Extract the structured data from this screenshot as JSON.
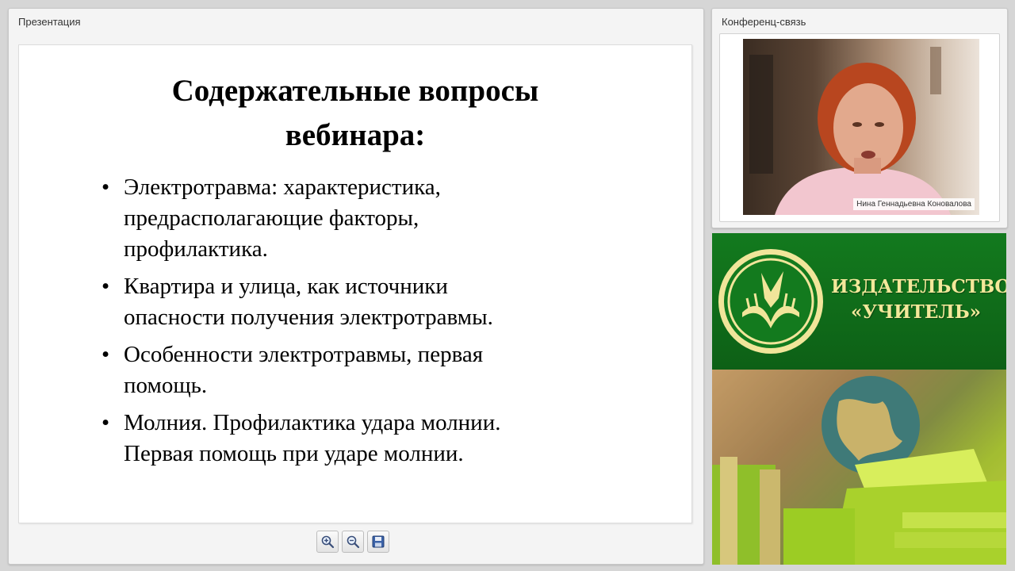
{
  "presentation": {
    "title": "Презентация",
    "slide": {
      "title_lines": [
        "Содержательные вопросы",
        "вебинара:"
      ],
      "bullets": [
        [
          "Электротравма: характеристика,",
          "предрасполагающие факторы,",
          "профилактика."
        ],
        [
          "Квартира и улица, как источники",
          "опасности получения электротравмы."
        ],
        [
          "Особенности электротравмы, первая",
          "помощь."
        ],
        [
          "Молния. Профилактика удара молнии.",
          "Первая помощь при ударе молнии."
        ]
      ],
      "bullet_glyph": "•"
    },
    "toolbar": {
      "zoom_in_icon": "zoom-in-icon",
      "zoom_out_icon": "zoom-out-icon",
      "save_icon": "save-icon"
    }
  },
  "conference": {
    "title": "Конференц-связь",
    "participant_name": "Нина Геннадьевна Коновалова"
  },
  "banner": {
    "line1": "ИЗДАТЕЛЬСТВО",
    "line2": "«УЧИТЕЛЬ»"
  },
  "colors": {
    "banner_green": "#137a1e",
    "banner_text": "#f3e89a",
    "slide_bg": "#ffffff"
  }
}
